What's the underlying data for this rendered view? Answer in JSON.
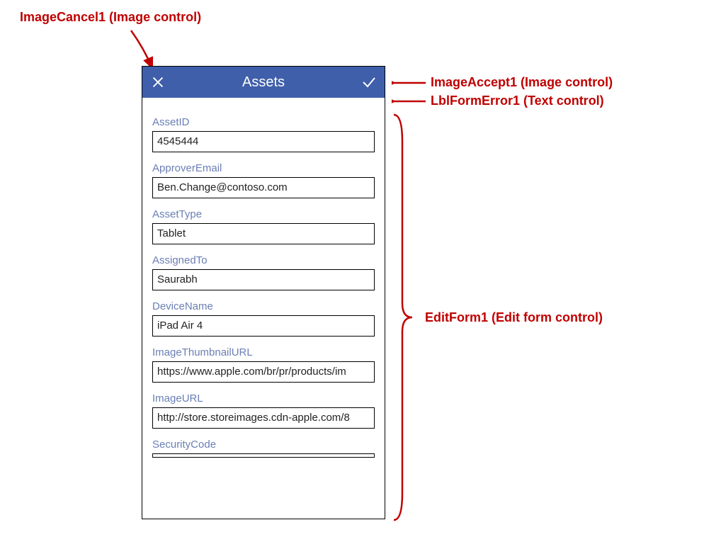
{
  "annotations": {
    "cancel": "ImageCancel1 (Image control)",
    "accept": "ImageAccept1 (Image control)",
    "error": "LblFormError1 (Text control)",
    "form": "EditForm1 (Edit form control)"
  },
  "header": {
    "title": "Assets"
  },
  "form": {
    "fields": [
      {
        "label": "AssetID",
        "value": "4545444"
      },
      {
        "label": "ApproverEmail",
        "value": "Ben.Change@contoso.com"
      },
      {
        "label": "AssetType",
        "value": "Tablet"
      },
      {
        "label": "AssignedTo",
        "value": "Saurabh"
      },
      {
        "label": "DeviceName",
        "value": "iPad Air 4"
      },
      {
        "label": "ImageThumbnailURL",
        "value": "https://www.apple.com/br/pr/products/im"
      },
      {
        "label": "ImageURL",
        "value": "http://store.storeimages.cdn-apple.com/8"
      },
      {
        "label": "SecurityCode",
        "value": ""
      }
    ]
  }
}
